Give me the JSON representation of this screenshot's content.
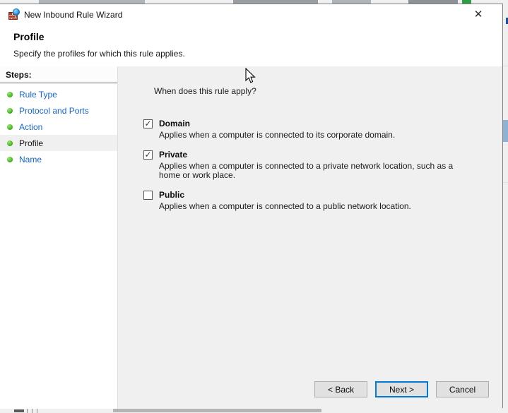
{
  "window": {
    "title": "New Inbound Rule Wizard"
  },
  "icons": {
    "close": "✕",
    "checkmark": "✓",
    "app_icon_name": "firewall-brick-globe-icon",
    "step_bullet_name": "green-dot-icon"
  },
  "header": {
    "title": "Profile",
    "subtitle": "Specify the profiles for which this rule applies."
  },
  "sidebar": {
    "heading": "Steps:",
    "items": [
      {
        "label": "Rule Type",
        "active": false
      },
      {
        "label": "Protocol and Ports",
        "active": false
      },
      {
        "label": "Action",
        "active": false
      },
      {
        "label": "Profile",
        "active": true
      },
      {
        "label": "Name",
        "active": false
      }
    ]
  },
  "content": {
    "question": "When does this rule apply?",
    "options": [
      {
        "label": "Domain",
        "checked": true,
        "description": "Applies when a computer is connected to its corporate domain."
      },
      {
        "label": "Private",
        "checked": true,
        "description": "Applies when a computer is connected to a private network location, such as a home or work place."
      },
      {
        "label": "Public",
        "checked": false,
        "description": "Applies when a computer is connected to a public network location."
      }
    ]
  },
  "footer": {
    "back_label": "< Back",
    "next_label": "Next >",
    "cancel_label": "Cancel"
  },
  "colors": {
    "link_blue": "#1565d8",
    "bullet_green": "#4cbc2a",
    "default_button_border": "#0078d7",
    "content_gray": "#f0f0f0",
    "dialog_white": "#ffffff"
  }
}
